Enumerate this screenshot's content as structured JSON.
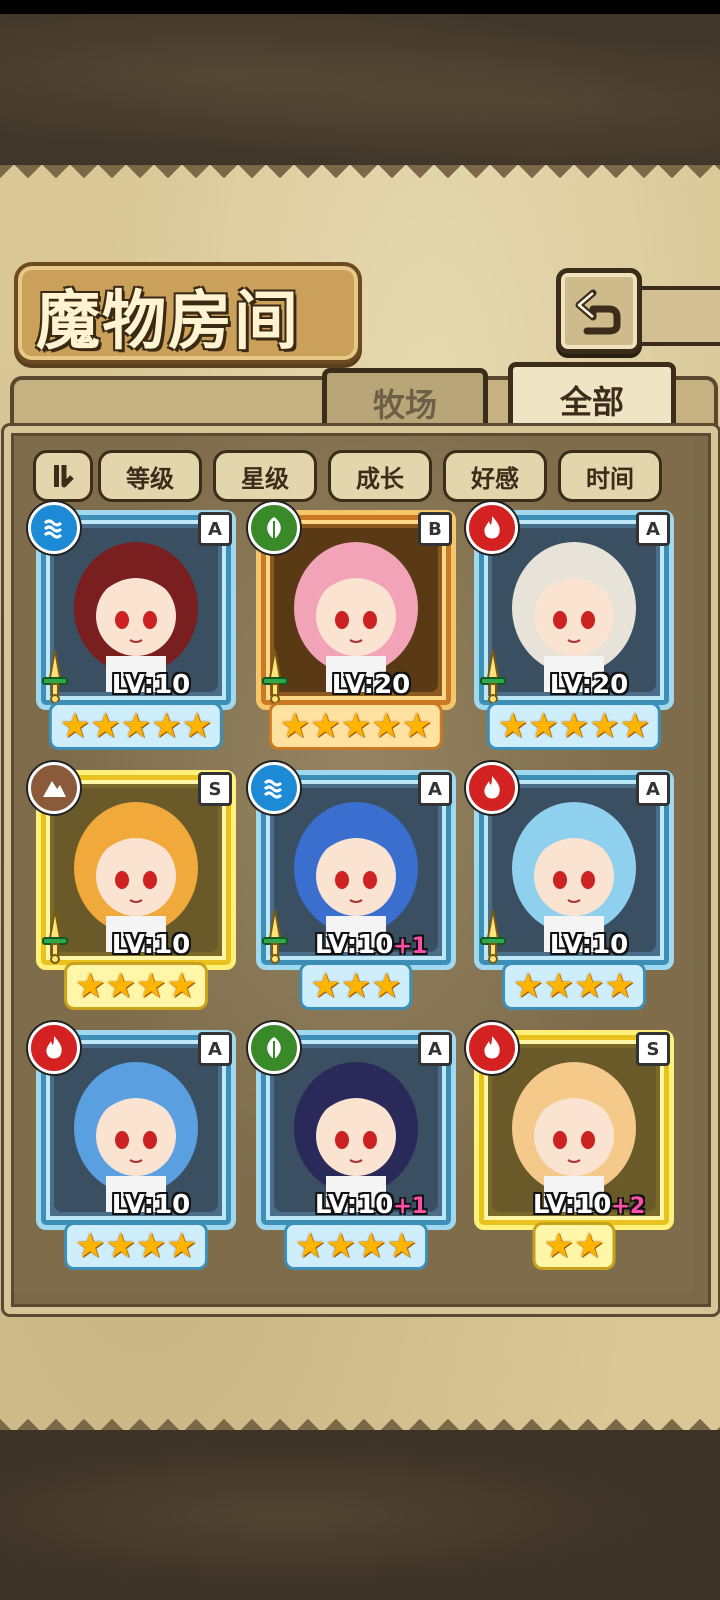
{
  "title": "魔物房间",
  "tabs": {
    "ranch": "牧场",
    "all": "全部"
  },
  "sort_buttons": [
    "等级",
    "星级",
    "成长",
    "好感",
    "时间"
  ],
  "colors": {
    "water": "#1d8ad6",
    "leaf": "#3a8a2a",
    "fire": "#d42222",
    "earth": "#8a5a3a",
    "plus": "#ff4fa8"
  },
  "monsters": [
    {
      "element": "water-icon",
      "rank": "A",
      "level": "LV:10",
      "plus": "",
      "stars": 5,
      "frame": "blue",
      "sword": true
    },
    {
      "element": "leaf-icon",
      "rank": "B",
      "level": "LV:20",
      "plus": "",
      "stars": 5,
      "frame": "gold",
      "sword": true
    },
    {
      "element": "fire-icon",
      "rank": "A",
      "level": "LV:20",
      "plus": "",
      "stars": 5,
      "frame": "blue",
      "sword": true
    },
    {
      "element": "earth-icon",
      "rank": "S",
      "level": "LV:10",
      "plus": "",
      "stars": 4,
      "frame": "yellow",
      "sword": true
    },
    {
      "element": "water-icon",
      "rank": "A",
      "level": "LV:10",
      "plus": "+1",
      "stars": 3,
      "frame": "blue",
      "sword": true
    },
    {
      "element": "fire-icon",
      "rank": "A",
      "level": "LV:10",
      "plus": "",
      "stars": 4,
      "frame": "blue",
      "sword": true
    },
    {
      "element": "fire-icon",
      "rank": "A",
      "level": "LV:10",
      "plus": "",
      "stars": 4,
      "frame": "blue",
      "sword": false
    },
    {
      "element": "leaf-icon",
      "rank": "A",
      "level": "LV:10",
      "plus": "+1",
      "stars": 4,
      "frame": "blue",
      "sword": false
    },
    {
      "element": "fire-icon",
      "rank": "S",
      "level": "LV:10",
      "plus": "+2",
      "stars": 2,
      "frame": "yellow",
      "sword": false
    }
  ]
}
